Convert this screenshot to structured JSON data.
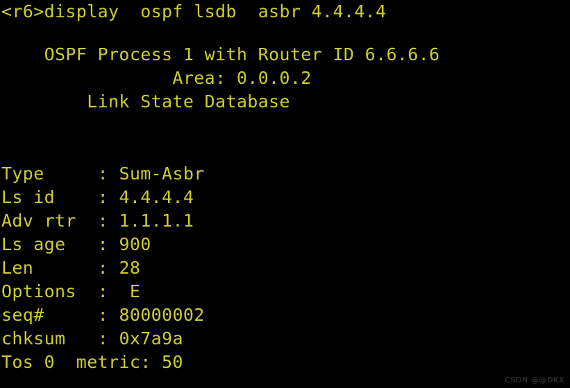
{
  "terminal": {
    "background_color": "#000000",
    "text_color": "#cccc33",
    "prompt_line": "<r6>display  ospf lsdb  asbr 4.4.4.4",
    "header_lines": [
      "    OSPF Process 1 with Router ID 6.6.6.6",
      "                Area: 0.0.0.2",
      "        Link State Database"
    ],
    "lsa": {
      "rows": [
        {
          "key": "Type     ",
          "sep": ": ",
          "value": "Sum-Asbr"
        },
        {
          "key": "Ls id    ",
          "sep": ": ",
          "value": "4.4.4.4"
        },
        {
          "key": "Adv rtr  ",
          "sep": ": ",
          "value": "1.1.1.1"
        },
        {
          "key": "Ls age   ",
          "sep": ": ",
          "value": "900"
        },
        {
          "key": "Len      ",
          "sep": ": ",
          "value": "28"
        },
        {
          "key": "Options  ",
          "sep": ": ",
          "value": " E"
        },
        {
          "key": "seq#     ",
          "sep": ": ",
          "value": "80000002"
        },
        {
          "key": "chksum   ",
          "sep": ": ",
          "value": "0x7a9a"
        },
        {
          "key": "Tos 0  metric",
          "sep": ": ",
          "value": "50"
        }
      ]
    }
  },
  "watermark": {
    "text": "CSDN @@DKX",
    "color": "#3c3c3c"
  }
}
